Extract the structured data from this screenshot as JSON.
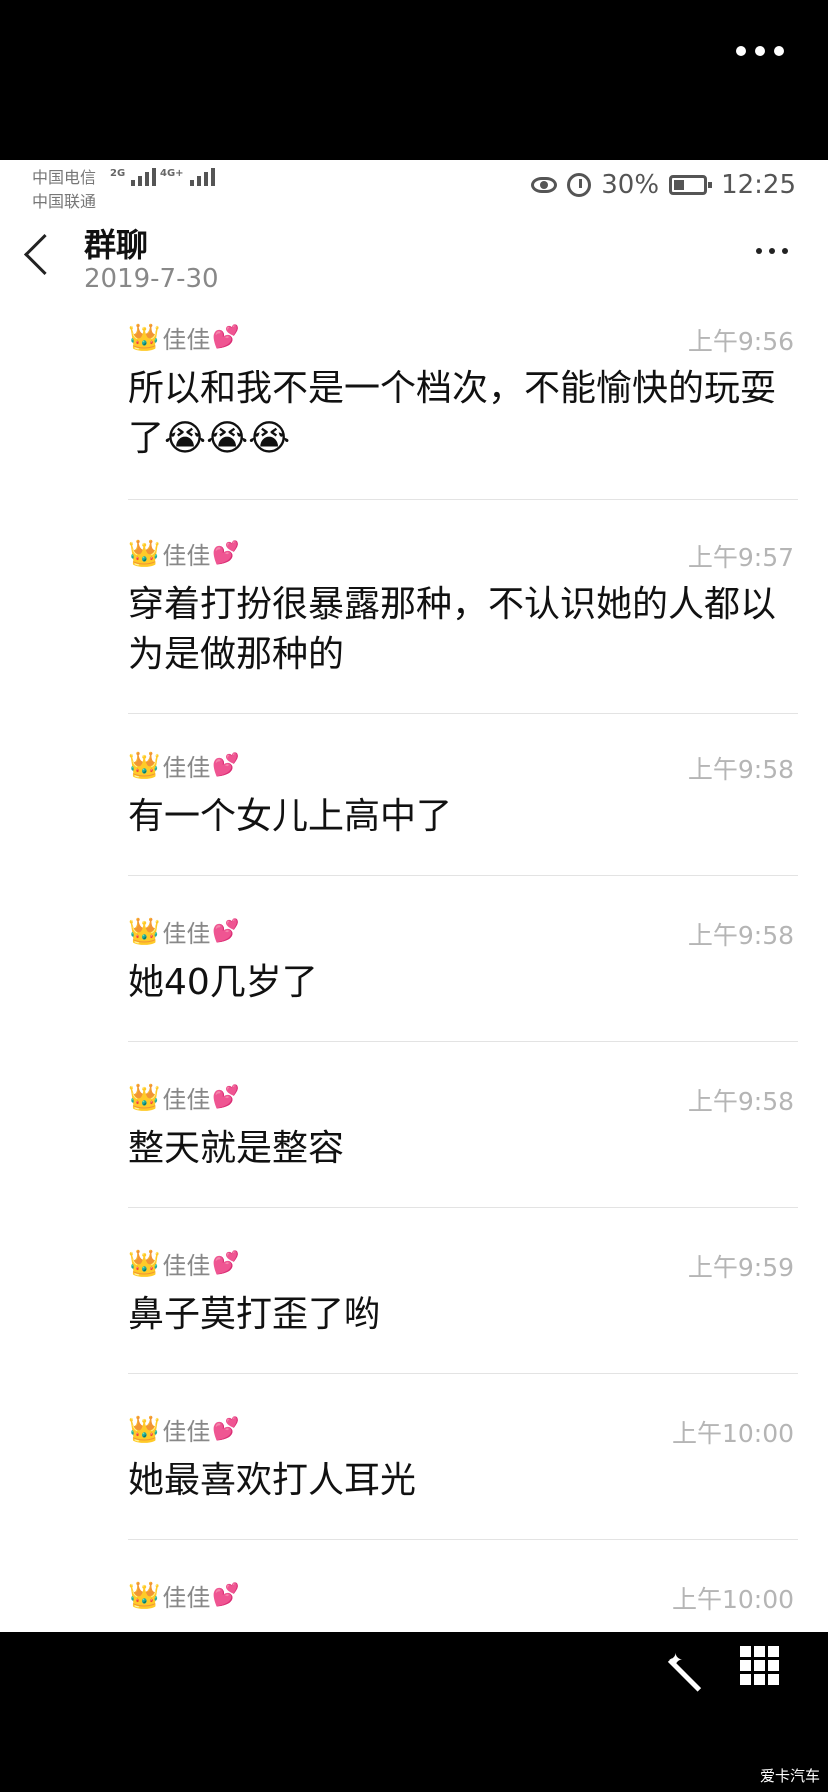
{
  "status_bar": {
    "carrier_1": "中国电信",
    "carrier_2": "中国联通",
    "net_1": "2G",
    "net_2": "4G+",
    "battery_percent": "30%",
    "time": "12:25"
  },
  "header": {
    "title": "群聊",
    "date": "2019-7-30"
  },
  "messages": [
    {
      "sender": "佳佳",
      "time": "上午9:56",
      "text": "所以和我不是一个档次，不能愉快的玩耍了😭😭😭"
    },
    {
      "sender": "佳佳",
      "time": "上午9:57",
      "text": "穿着打扮很暴露那种，不认识她的人都以为是做那种的"
    },
    {
      "sender": "佳佳",
      "time": "上午9:58",
      "text": "有一个女儿上高中了"
    },
    {
      "sender": "佳佳",
      "time": "上午9:58",
      "text": "她40几岁了"
    },
    {
      "sender": "佳佳",
      "time": "上午9:58",
      "text": "整天就是整容"
    },
    {
      "sender": "佳佳",
      "time": "上午9:59",
      "text": "鼻子莫打歪了哟"
    },
    {
      "sender": "佳佳",
      "time": "上午10:00",
      "text": "她最喜欢打人耳光"
    },
    {
      "sender": "佳佳",
      "time": "上午10:00",
      "text": ""
    }
  ],
  "icons": {
    "crown": "👑",
    "heart": "💕"
  },
  "watermark": "爱卡汽车"
}
